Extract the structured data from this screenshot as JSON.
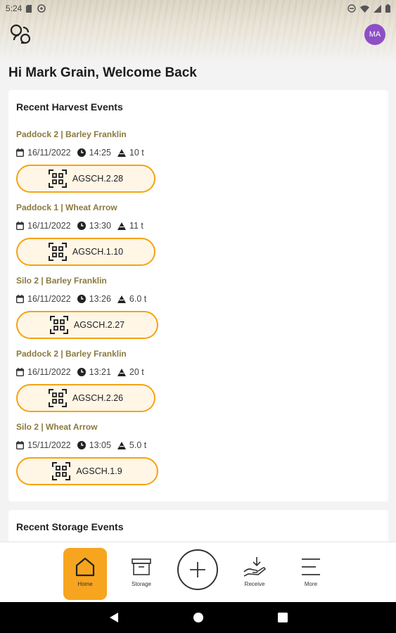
{
  "status_bar": {
    "time": "5:24",
    "left_icons": [
      "sd-card-icon",
      "sync-icon"
    ],
    "right_icons": [
      "dnd-icon",
      "wifi-icon",
      "signal-icon",
      "battery-icon"
    ]
  },
  "header": {
    "logo_icon": "app-logo-icon",
    "avatar_initials": "MA",
    "avatar_color": "#8e4fc6"
  },
  "welcome_text": "Hi Mark Grain, Welcome Back",
  "harvest_section": {
    "title": "Recent Harvest Events",
    "events": [
      {
        "name": "Paddock 2 | Barley Franklin",
        "date": "16/11/2022",
        "time": "14:25",
        "weight": "10 t",
        "code": "AGSCH.2.28"
      },
      {
        "name": "Paddock 1 | Wheat Arrow",
        "date": "16/11/2022",
        "time": "13:30",
        "weight": "11 t",
        "code": "AGSCH.1.10"
      },
      {
        "name": "Silo 2 | Barley Franklin",
        "date": "16/11/2022",
        "time": "13:26",
        "weight": "6.0 t",
        "code": "AGSCH.2.27"
      },
      {
        "name": "Paddock 2 | Barley Franklin",
        "date": "16/11/2022",
        "time": "13:21",
        "weight": "20 t",
        "code": "AGSCH.2.26"
      },
      {
        "name": "Silo 2 | Wheat Arrow",
        "date": "15/11/2022",
        "time": "13:05",
        "weight": "5.0 t",
        "code": "AGSCH.1.9"
      }
    ]
  },
  "storage_section": {
    "title": "Recent Storage Events"
  },
  "bottom_nav": {
    "items": [
      {
        "label": "Home",
        "icon": "home-icon",
        "active": true
      },
      {
        "label": "Storage",
        "icon": "archive-box-icon"
      },
      {
        "label": "",
        "icon": "plus-icon"
      },
      {
        "label": "Receive",
        "icon": "receive-icon"
      },
      {
        "label": "More",
        "icon": "menu-icon"
      }
    ]
  },
  "colors": {
    "accent": "#f7a51f",
    "button_border": "#f5a312",
    "button_fill": "#fff6e6",
    "event_name": "#8a7a3e"
  }
}
